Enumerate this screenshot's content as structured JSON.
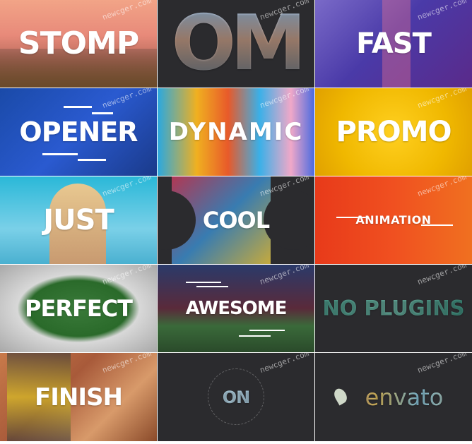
{
  "watermark": "newcger.com",
  "tiles": [
    {
      "text": "STOMP"
    },
    {
      "text": "OM"
    },
    {
      "text": "FAST"
    },
    {
      "text": "OPENER"
    },
    {
      "text": "DYNAMIC"
    },
    {
      "text": "PROMO"
    },
    {
      "text": "JUST"
    },
    {
      "text": "COOL"
    },
    {
      "text": "ANIMATION"
    },
    {
      "text": "PERFECT"
    },
    {
      "text": "AWESOME"
    },
    {
      "text": "NO PLUGINS"
    },
    {
      "text": "FINISH"
    },
    {
      "text": "ON"
    },
    {
      "text": "envato"
    }
  ]
}
